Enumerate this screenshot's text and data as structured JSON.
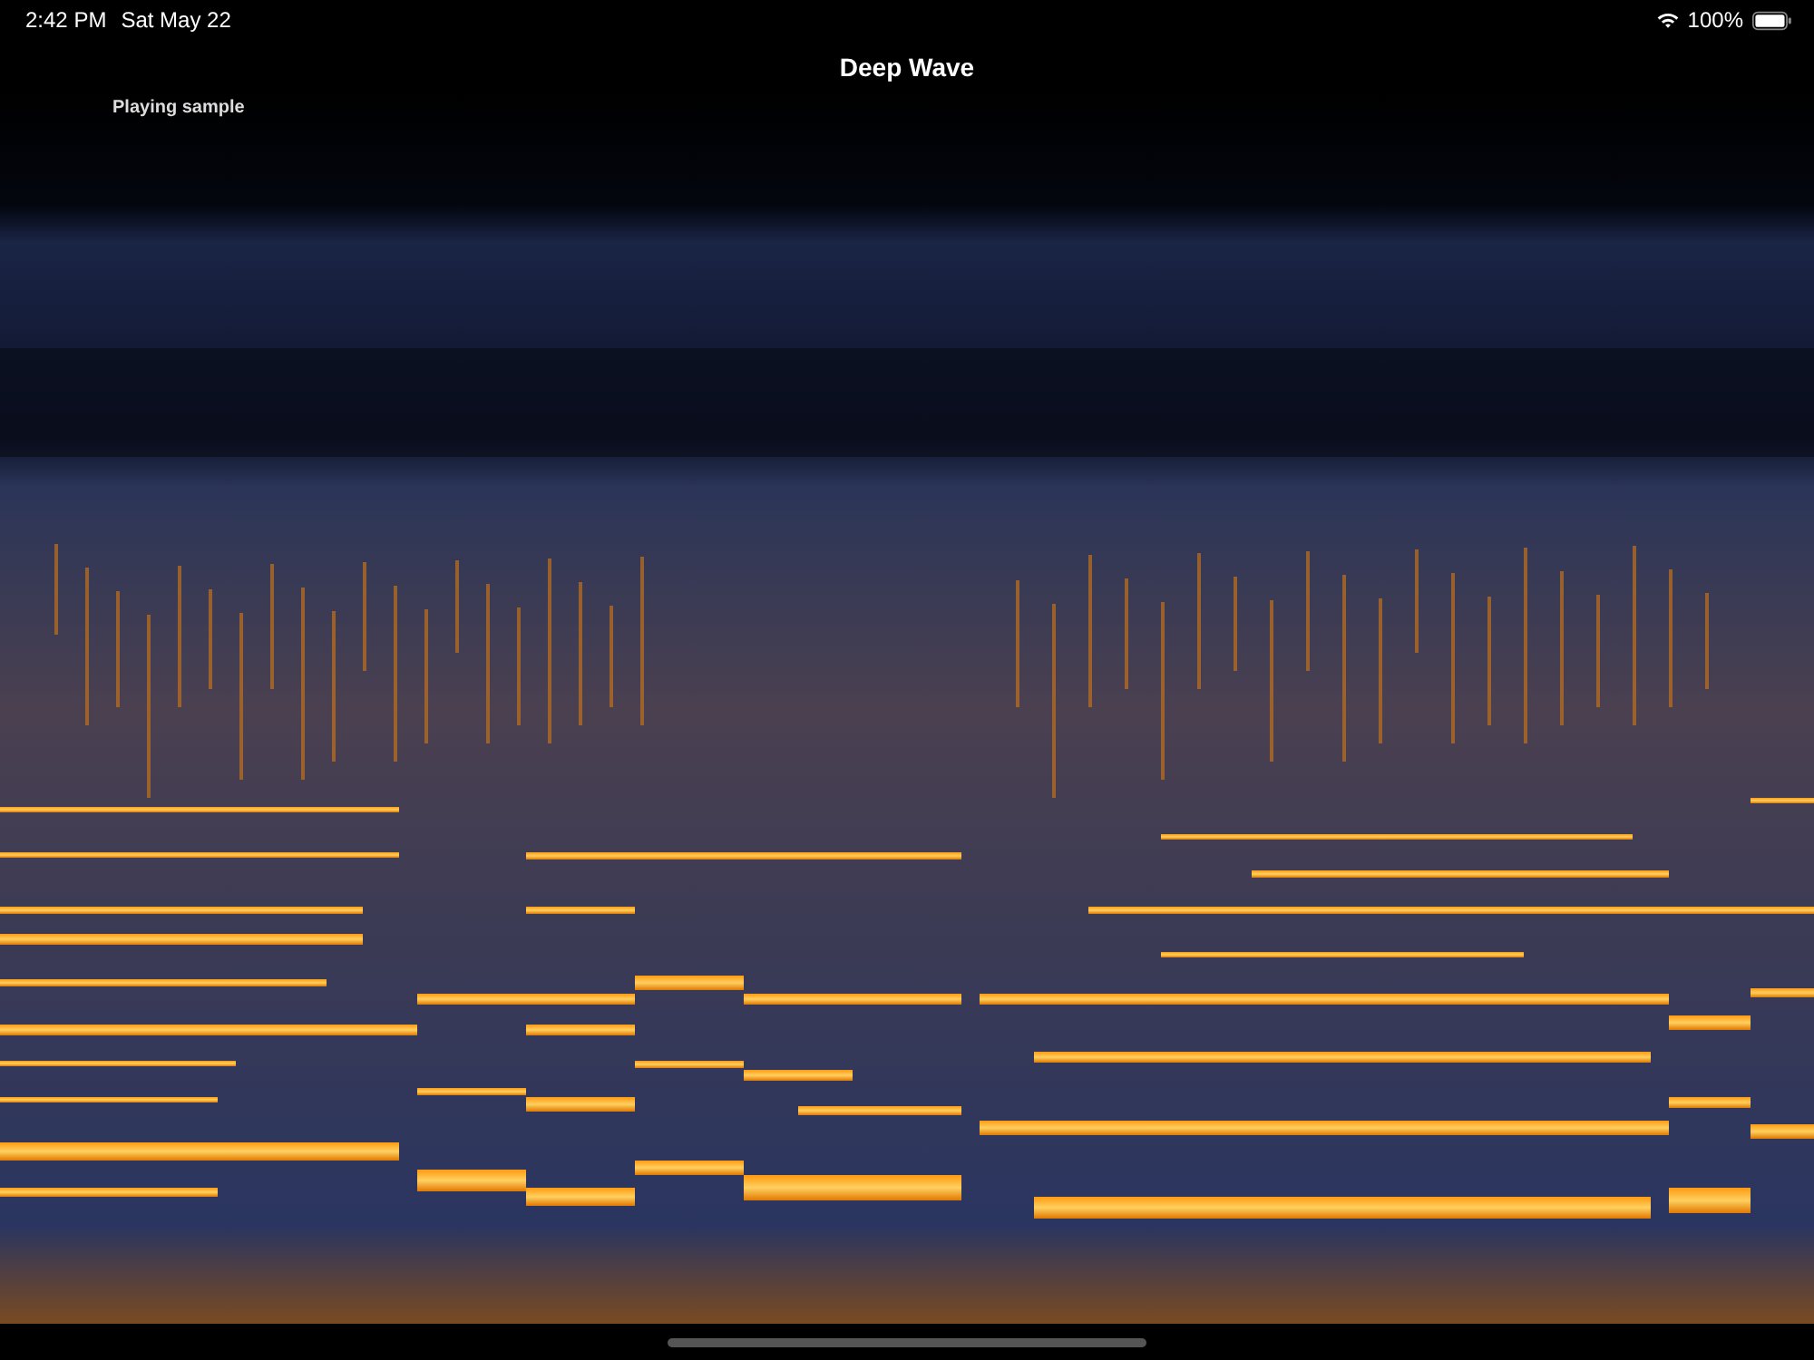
{
  "status_bar": {
    "time": "2:42 PM",
    "date": "Sat May 22",
    "battery": "100%"
  },
  "navigation": {
    "title": "Deep Wave"
  },
  "spectrogram": {
    "caption": "Playing sample"
  }
}
